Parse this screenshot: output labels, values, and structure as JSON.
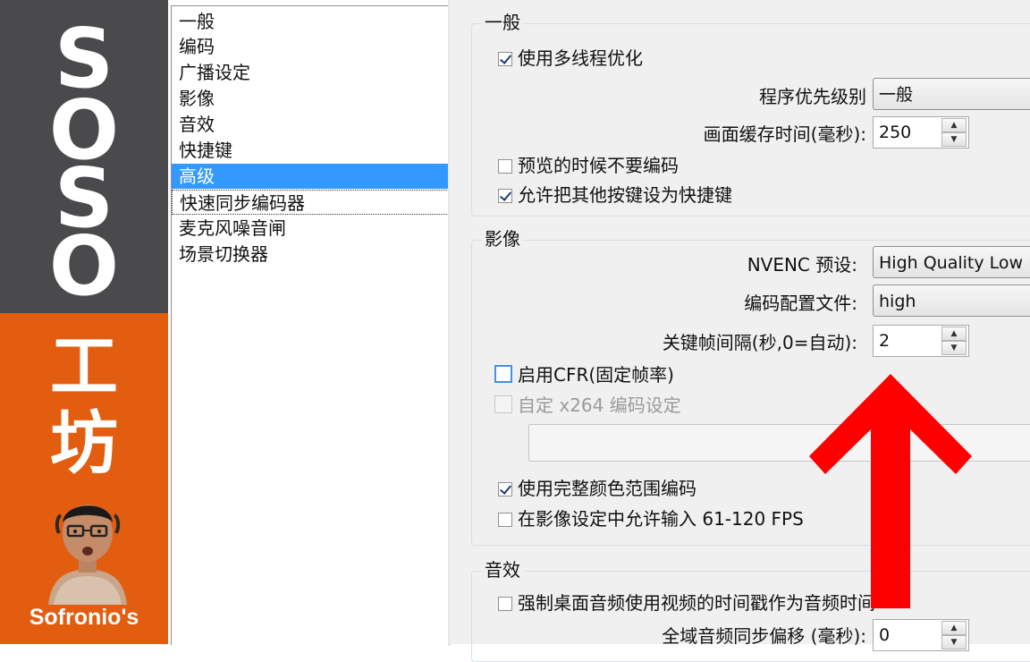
{
  "brand": {
    "letters": [
      "S",
      "O",
      "S",
      "O"
    ],
    "cjk": [
      "工",
      "坊"
    ],
    "name": "Sofronio's",
    "colors": {
      "top": "#4a4a4c",
      "bottom": "#e35d10"
    }
  },
  "nav": {
    "items": [
      {
        "label": "一般"
      },
      {
        "label": "编码"
      },
      {
        "label": "广播设定"
      },
      {
        "label": "影像"
      },
      {
        "label": "音效"
      },
      {
        "label": "快捷键"
      },
      {
        "label": "高级"
      },
      {
        "label": "快速同步编码器"
      },
      {
        "label": "麦克风噪音闸"
      },
      {
        "label": "场景切换器"
      }
    ],
    "selected": "高级"
  },
  "general": {
    "title": "一般",
    "multithread": {
      "label": "使用多线程优化",
      "checked": true
    },
    "priority": {
      "label": "程序优先级别",
      "value": "一般"
    },
    "buffer": {
      "label": "画面缓存时间(毫秒):",
      "value": "250"
    },
    "no_encode_preview": {
      "label": "预览的时候不要编码",
      "checked": false
    },
    "allow_hotkeys": {
      "label": "允许把其他按键设为快捷键",
      "checked": true
    }
  },
  "video": {
    "title": "影像",
    "nvenc": {
      "label": "NVENC 预设:",
      "value": "High Quality Low La"
    },
    "profile": {
      "label": "编码配置文件:",
      "value": "high"
    },
    "keyframe": {
      "label": "关键帧间隔(秒,0=自动):",
      "value": "2"
    },
    "cfr": {
      "label": "启用CFR(固定帧率)",
      "checked": false
    },
    "x264": {
      "label": "自定 x264 编码设定",
      "checked": false
    },
    "full_range": {
      "label": "使用完整颜色范围编码",
      "checked": true
    },
    "allow_fps": {
      "label": "在影像设定中允许输入 61-120 FPS",
      "checked": false
    }
  },
  "audio": {
    "title": "音效",
    "force_timestamp": {
      "label": "强制桌面音频使用视频的时间戳作为音频时间",
      "checked": false
    },
    "global_offset": {
      "label": "全域音频同步偏移 (毫秒):",
      "value": "0"
    }
  },
  "annotation": {
    "arrow_color": "#ff0000"
  },
  "icons": [
    "spin-up-icon",
    "spin-down-icon",
    "checkmark-icon",
    "red-arrow-up-icon"
  ]
}
